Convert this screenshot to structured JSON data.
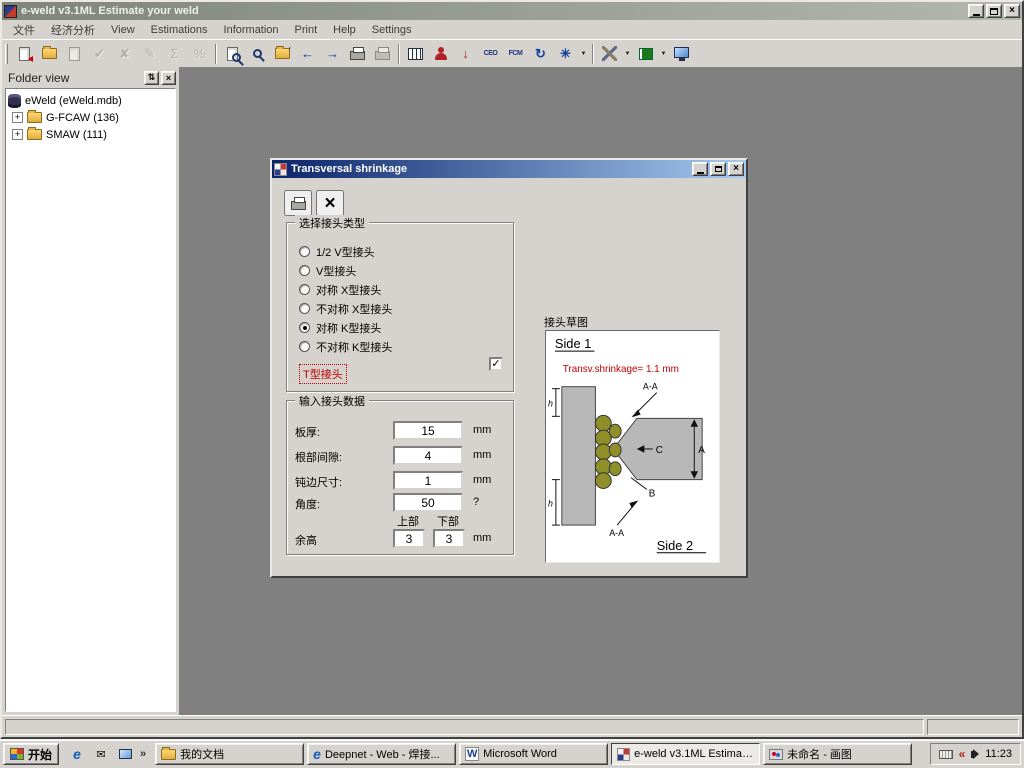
{
  "window": {
    "title": "e-weld v3.1ML Estimate your weld"
  },
  "menu": {
    "items": [
      "文件",
      "经济分析",
      "View",
      "Estimations",
      "Information",
      "Print",
      "Help",
      "Settings"
    ]
  },
  "icons": {
    "check": "✓",
    "checkmark": "✔",
    "crossmark": "✘",
    "pencil": "✎",
    "sigma": "Σ",
    "percent": "%",
    "back": "←",
    "forward": "→",
    "up": "↑",
    "down": "↓",
    "refresh": "↻",
    "sparkle": "✳",
    "ceo": "CEO",
    "fcm": "FCM",
    "dropdown": "▼",
    "dock": "⇅",
    "close": "×",
    "plus": "+",
    "ie": "e",
    "word": "W",
    "envelope": "✉",
    "chevron_right": "»",
    "chevron_left": "«"
  },
  "folder_view": {
    "title": "Folder view",
    "root": "eWeld (eWeld.mdb)",
    "nodes": [
      {
        "label": "G-FCAW (136)"
      },
      {
        "label": "SMAW (111)"
      }
    ]
  },
  "dialog": {
    "title": "Transversal shrinkage",
    "joint_group_label": "选择接头类型",
    "joint_types": [
      "1/2 V型接头",
      "V型接头",
      "对称 X型接头",
      "不对称 X型接头",
      "对称 K型接头",
      "不对称 K型接头"
    ],
    "selected_joint": "对称 K型接头",
    "t_joint_label": "T型接头",
    "input_group_label": "输入接头数据",
    "fields": [
      {
        "label": "板厚:",
        "value": "15",
        "unit": "mm"
      },
      {
        "label": "根部间隙:",
        "value": "4",
        "unit": "mm"
      },
      {
        "label": "钝边尺寸:",
        "value": "1",
        "unit": "mm"
      },
      {
        "label": "角度:",
        "value": "50",
        "unit": "?"
      }
    ],
    "reinforcement": {
      "label": "余高",
      "header_top": "上部",
      "header_bottom": "下部",
      "value_top": "3",
      "value_bottom": "3",
      "unit": "mm"
    },
    "sketch_label": "接头草图",
    "sketch": {
      "side1": "Side 1",
      "side2": "Side 2",
      "shrinkage_text": "Transv.shrinkage= 1.1 mm",
      "dim_top": "A-A",
      "dim_bottom": "A-A",
      "dim_h_top": "h",
      "dim_h_bottom": "h",
      "dim_a": "A",
      "dim_b": "B",
      "dim_c": "C"
    }
  },
  "taskbar": {
    "start_label": "开始",
    "buttons": [
      {
        "label": "我的文档"
      },
      {
        "label": "Deepnet - Web - 焊接..."
      },
      {
        "label": "Microsoft Word"
      },
      {
        "label": "e-weld v3.1ML Estimat..."
      },
      {
        "label": "未命名 - 画图"
      }
    ],
    "clock": "11:23"
  }
}
